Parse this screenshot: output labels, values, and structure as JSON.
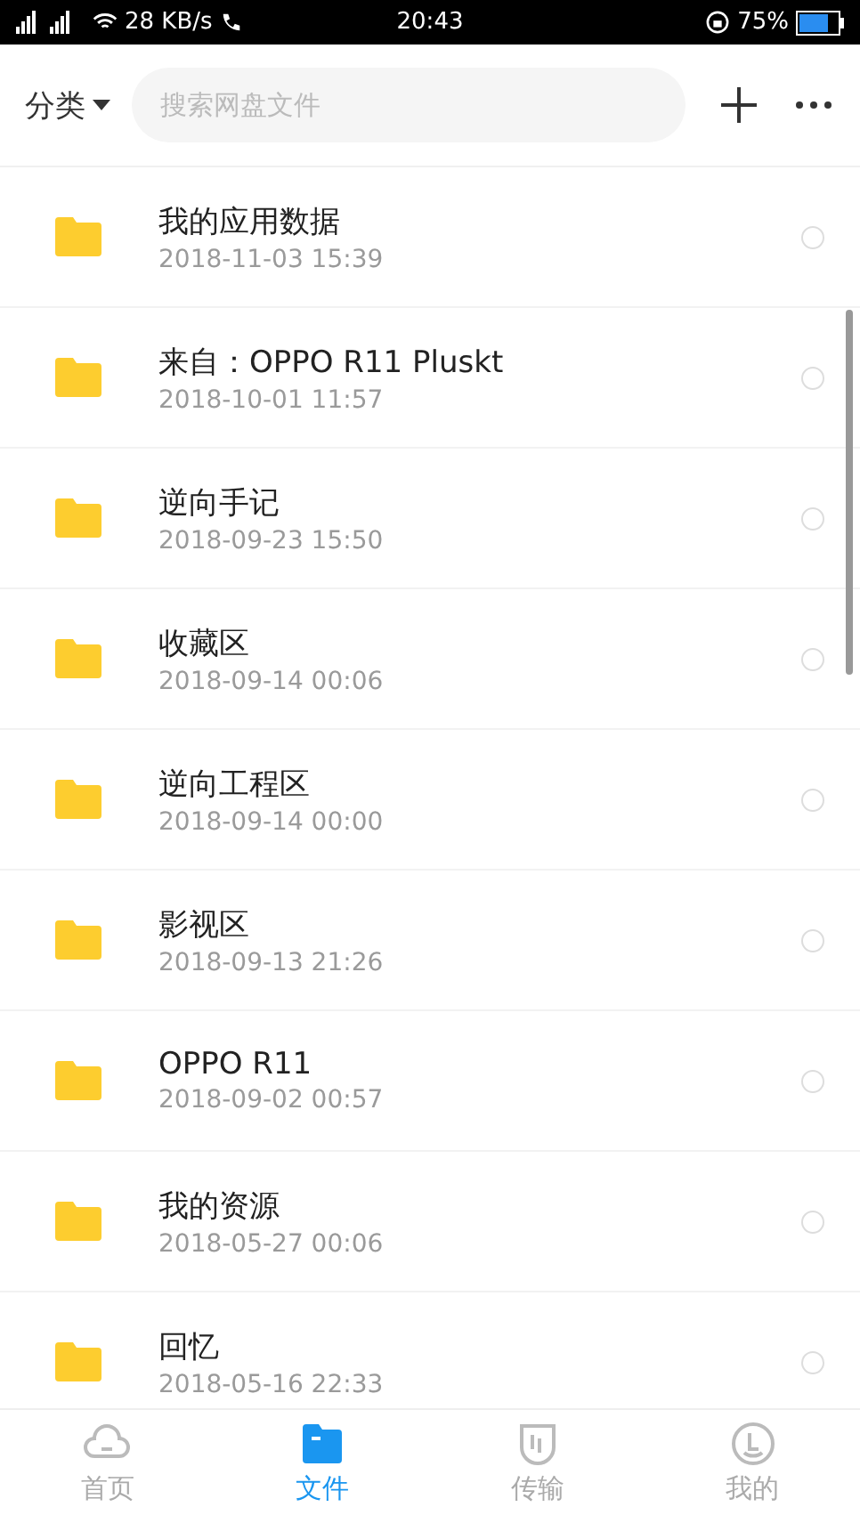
{
  "status_bar": {
    "speed": "28 KB/s",
    "time": "20:43",
    "battery": "75%"
  },
  "header": {
    "category": "分类",
    "search": {
      "placeholder": "搜索网盘文件"
    }
  },
  "files": [
    {
      "name": "我的应用数据",
      "date": "2018-11-03  15:39",
      "selected": false
    },
    {
      "name": "来自：OPPO R11 Pluskt",
      "date": "2018-10-01  11:57",
      "selected": false
    },
    {
      "name": "逆向手记",
      "date": "2018-09-23  15:50",
      "selected": false
    },
    {
      "name": "收藏区",
      "date": "2018-09-14  00:06",
      "selected": false
    },
    {
      "name": "逆向工程区",
      "date": "2018-09-14  00:00",
      "selected": false
    },
    {
      "name": "影视区",
      "date": "2018-09-13  21:26",
      "selected": false
    },
    {
      "name": "OPPO R11",
      "date": "2018-09-02  00:57",
      "selected": false
    },
    {
      "name": "我的资源",
      "date": "2018-05-27  00:06",
      "selected": false
    },
    {
      "name": "回忆",
      "date": "2018-05-16  22:33",
      "selected": false
    }
  ],
  "tabs": [
    {
      "kind": "home",
      "label": "首页",
      "selected": false
    },
    {
      "kind": "files",
      "label": "文件",
      "selected": true
    },
    {
      "kind": "transfer",
      "label": "传输",
      "selected": false
    },
    {
      "kind": "me",
      "label": "我的",
      "selected": false
    }
  ]
}
